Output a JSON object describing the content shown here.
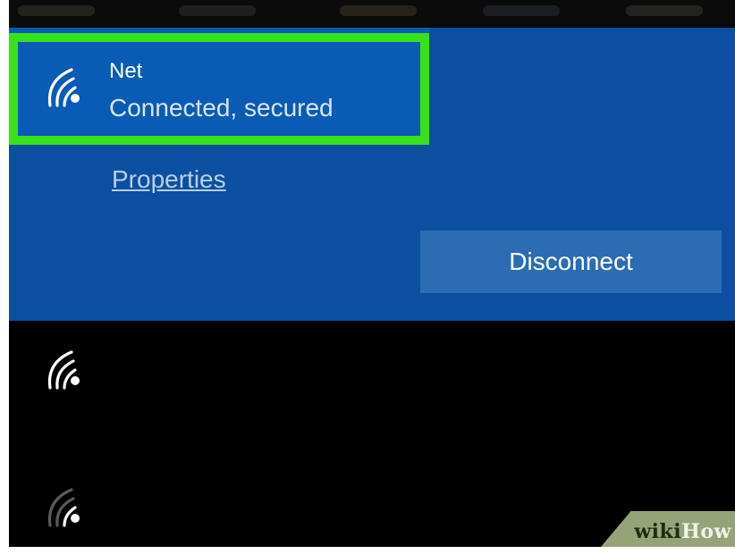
{
  "connected_network": {
    "name": "Net",
    "status": "Connected, secured",
    "properties_label": "Properties",
    "disconnect_label": "Disconnect",
    "icon": "wifi-icon"
  },
  "other_networks": [
    {
      "icon": "wifi-icon"
    },
    {
      "icon": "wifi-icon"
    }
  ],
  "highlight_color": "#37e21b",
  "accent_color": "#0b4fa0",
  "watermark": {
    "part1": "wiki",
    "part2": "How"
  }
}
